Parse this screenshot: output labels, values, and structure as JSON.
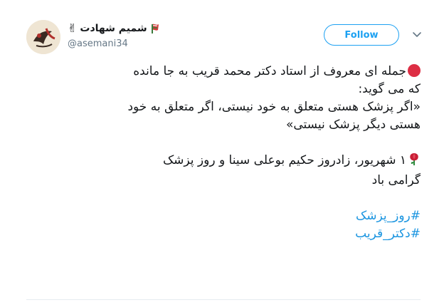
{
  "author": {
    "display_name": "شمیم شهادت",
    "handle": "@asemani34",
    "name_emoji_left": "✌",
    "avatar_icon": "calligraphy-avatar-icon",
    "name_badge_icon": "flag-ribbon-icon"
  },
  "follow_button": {
    "label": "Follow"
  },
  "menu_icon": "chevron-down-icon",
  "tweet": {
    "lines": [
      "جمله ای معروف از استاد دکتر محمد قریب به جا مانده",
      "که می گوید:",
      "«اگر پزشک هستی متعلق به خود نیستی، اگر متعلق به خود",
      "هستی دیگر پزشک نیستی»"
    ],
    "lines2": [
      "۱ شهریور، زادروز حکیم بوعلی سینا و روز پزشک",
      "گرامی باد"
    ],
    "hashtags": [
      "#روز_پزشک",
      "#دکتر_قریب"
    ],
    "bullet_icon": "red-circle-icon",
    "rose_icon": "rose-icon"
  },
  "colors": {
    "accent": "#1da1f2",
    "hashtag": "#1b95e0",
    "text": "#14171a",
    "muted": "#657786",
    "red_dot": "#dd2e44"
  }
}
